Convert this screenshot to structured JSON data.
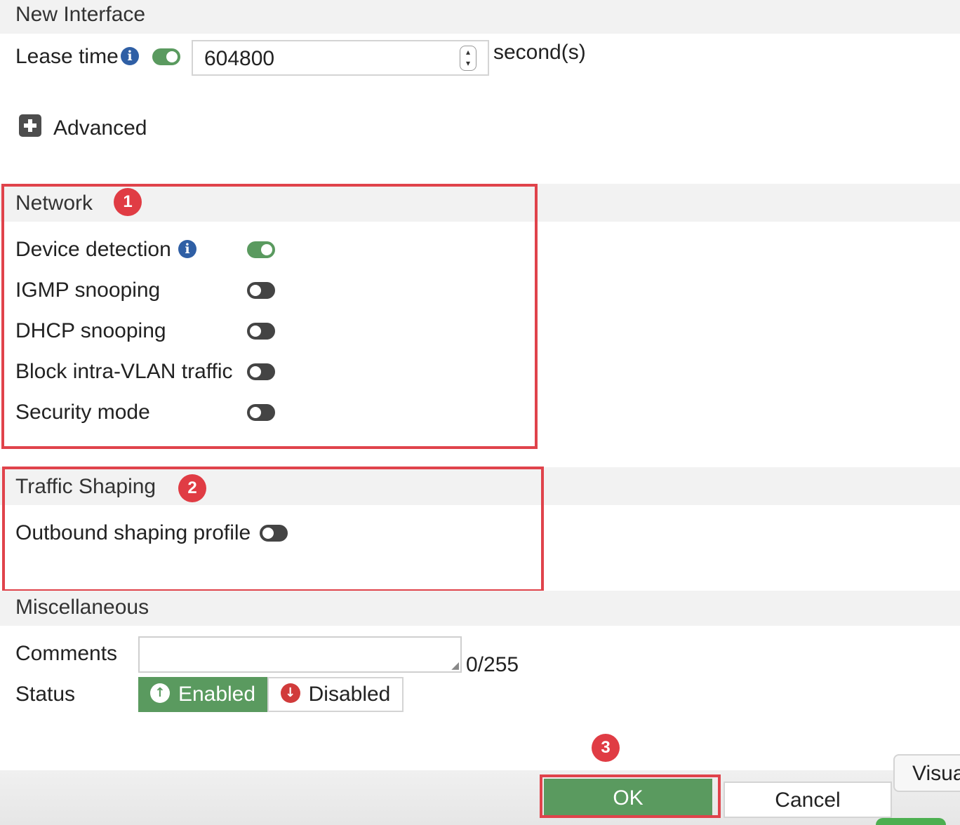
{
  "header": {
    "title": "New Interface"
  },
  "lease": {
    "label": "Lease time",
    "value": "604800",
    "unit": "second(s)"
  },
  "advanced": {
    "label": "Advanced"
  },
  "network": {
    "title": "Network",
    "badge": "1",
    "items": [
      {
        "label": "Device detection",
        "enabled": true
      },
      {
        "label": "IGMP snooping",
        "enabled": false
      },
      {
        "label": "DHCP snooping",
        "enabled": false
      },
      {
        "label": "Block intra-VLAN traffic",
        "enabled": false
      },
      {
        "label": "Security mode",
        "enabled": false
      }
    ]
  },
  "traffic": {
    "title": "Traffic Shaping",
    "badge": "2",
    "outbound_label": "Outbound shaping profile"
  },
  "misc": {
    "title": "Miscellaneous",
    "comments_label": "Comments",
    "comments_count": "0/255",
    "status_label": "Status",
    "enabled_label": "Enabled",
    "disabled_label": "Disabled"
  },
  "footer": {
    "ok_label": "OK",
    "cancel_label": "Cancel",
    "ok_badge": "3",
    "visual_label": "Visua"
  },
  "colors": {
    "accent_green": "#5a9a5f",
    "highlight_red": "#e0434b",
    "info_blue": "#2f5fa5"
  }
}
